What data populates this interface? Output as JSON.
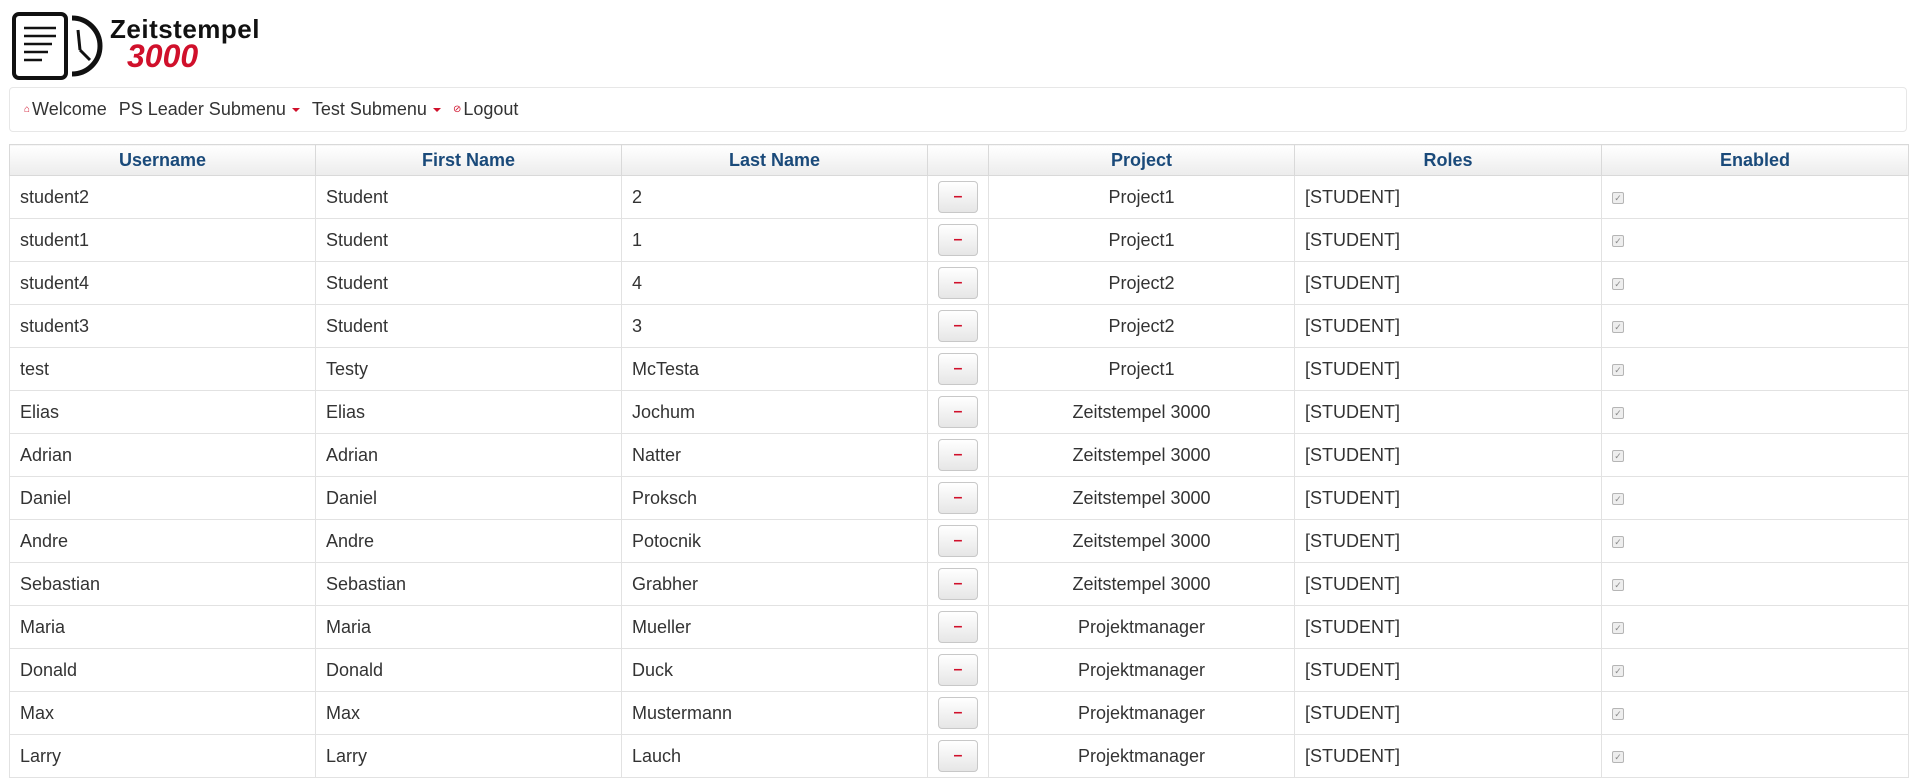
{
  "app": {
    "logo_line1": "Zeitstempel",
    "logo_line2": "3000",
    "accent_color": "#d0102b",
    "header_text_color": "#1a4a7a"
  },
  "nav": {
    "welcome": {
      "icon": "home-icon",
      "label": "Welcome"
    },
    "ps_leader": {
      "label": "PS Leader Submenu"
    },
    "test": {
      "label": "Test Submenu"
    },
    "logout": {
      "icon": "logout-icon",
      "label": "Logout"
    }
  },
  "table": {
    "columns": [
      "Username",
      "First Name",
      "Last Name",
      "",
      "Project",
      "Roles",
      "Enabled"
    ],
    "delete_label": "–",
    "rows": [
      {
        "username": "student2",
        "first": "Student",
        "last": "2",
        "project": "Project1",
        "roles": "[STUDENT]",
        "enabled": true
      },
      {
        "username": "student1",
        "first": "Student",
        "last": "1",
        "project": "Project1",
        "roles": "[STUDENT]",
        "enabled": true
      },
      {
        "username": "student4",
        "first": "Student",
        "last": "4",
        "project": "Project2",
        "roles": "[STUDENT]",
        "enabled": true
      },
      {
        "username": "student3",
        "first": "Student",
        "last": "3",
        "project": "Project2",
        "roles": "[STUDENT]",
        "enabled": true
      },
      {
        "username": "test",
        "first": "Testy",
        "last": "McTesta",
        "project": "Project1",
        "roles": "[STUDENT]",
        "enabled": true
      },
      {
        "username": "Elias",
        "first": "Elias",
        "last": "Jochum",
        "project": "Zeitstempel 3000",
        "roles": "[STUDENT]",
        "enabled": true
      },
      {
        "username": "Adrian",
        "first": "Adrian",
        "last": "Natter",
        "project": "Zeitstempel 3000",
        "roles": "[STUDENT]",
        "enabled": true
      },
      {
        "username": "Daniel",
        "first": "Daniel",
        "last": "Proksch",
        "project": "Zeitstempel 3000",
        "roles": "[STUDENT]",
        "enabled": true
      },
      {
        "username": "Andre",
        "first": "Andre",
        "last": "Potocnik",
        "project": "Zeitstempel 3000",
        "roles": "[STUDENT]",
        "enabled": true
      },
      {
        "username": "Sebastian",
        "first": "Sebastian",
        "last": "Grabher",
        "project": "Zeitstempel 3000",
        "roles": "[STUDENT]",
        "enabled": true
      },
      {
        "username": "Maria",
        "first": "Maria",
        "last": "Mueller",
        "project": "Projektmanager",
        "roles": "[STUDENT]",
        "enabled": true
      },
      {
        "username": "Donald",
        "first": "Donald",
        "last": "Duck",
        "project": "Projektmanager",
        "roles": "[STUDENT]",
        "enabled": true
      },
      {
        "username": "Max",
        "first": "Max",
        "last": "Mustermann",
        "project": "Projektmanager",
        "roles": "[STUDENT]",
        "enabled": true
      },
      {
        "username": "Larry",
        "first": "Larry",
        "last": "Lauch",
        "project": "Projektmanager",
        "roles": "[STUDENT]",
        "enabled": true
      }
    ]
  }
}
